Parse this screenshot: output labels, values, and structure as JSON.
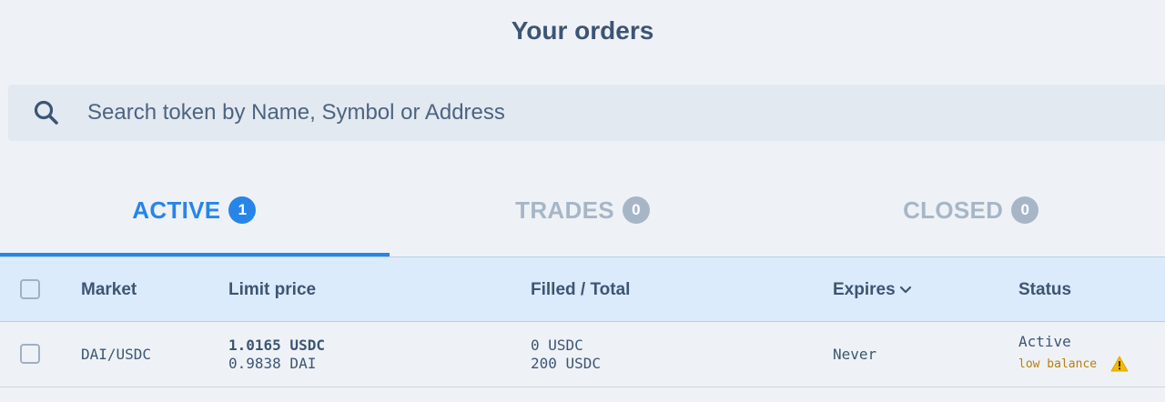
{
  "page": {
    "title": "Your orders"
  },
  "search": {
    "placeholder": "Search token by Name, Symbol or Address"
  },
  "tabs": [
    {
      "label": "ACTIVE",
      "count": "1"
    },
    {
      "label": "TRADES",
      "count": "0"
    },
    {
      "label": "CLOSED",
      "count": "0"
    }
  ],
  "table": {
    "headers": {
      "market": "Market",
      "limit_price": "Limit price",
      "filled_total": "Filled / Total",
      "expires": "Expires",
      "status": "Status"
    },
    "rows": [
      {
        "market": "DAI/USDC",
        "limit_price_line1": "1.0165 USDC",
        "limit_price_line2": "0.9838 DAI",
        "filled": "0 USDC",
        "total": "200 USDC",
        "expires": "Never",
        "status": "Active",
        "status_note": "low balance"
      }
    ]
  },
  "colors": {
    "accent": "#2785e8",
    "inactive_tab": "#a7b6c7",
    "text": "#3d5574",
    "warning": "#f0b90b"
  },
  "icons": {
    "search": "search-icon",
    "sort": "chevron-down-icon",
    "warning": "warning-icon"
  }
}
